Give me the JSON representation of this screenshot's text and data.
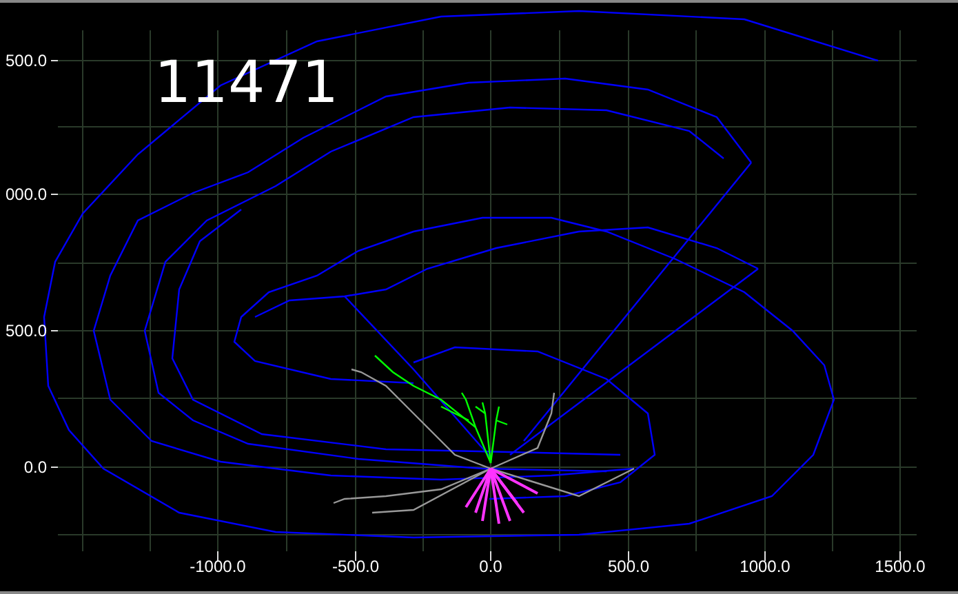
{
  "plot": {
    "title": "11471",
    "y_ticks": [
      "500.0",
      "000.0",
      "500.0",
      "0.0"
    ],
    "x_ticks": [
      "-1000.0",
      "-500.0",
      "0.0",
      "500.0",
      "1000.0",
      "1500.0"
    ]
  }
}
